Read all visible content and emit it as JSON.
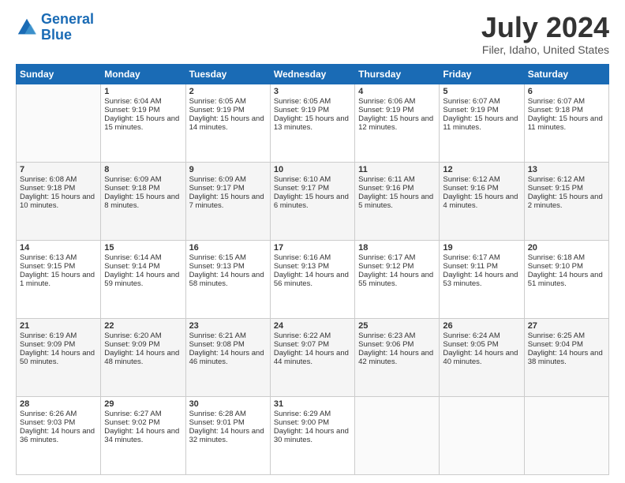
{
  "logo": {
    "line1": "General",
    "line2": "Blue"
  },
  "title": "July 2024",
  "subtitle": "Filer, Idaho, United States",
  "days_header": [
    "Sunday",
    "Monday",
    "Tuesday",
    "Wednesday",
    "Thursday",
    "Friday",
    "Saturday"
  ],
  "weeks": [
    [
      {
        "day": "",
        "sunrise": "",
        "sunset": "",
        "daylight": ""
      },
      {
        "day": "1",
        "sunrise": "Sunrise: 6:04 AM",
        "sunset": "Sunset: 9:19 PM",
        "daylight": "Daylight: 15 hours and 15 minutes."
      },
      {
        "day": "2",
        "sunrise": "Sunrise: 6:05 AM",
        "sunset": "Sunset: 9:19 PM",
        "daylight": "Daylight: 15 hours and 14 minutes."
      },
      {
        "day": "3",
        "sunrise": "Sunrise: 6:05 AM",
        "sunset": "Sunset: 9:19 PM",
        "daylight": "Daylight: 15 hours and 13 minutes."
      },
      {
        "day": "4",
        "sunrise": "Sunrise: 6:06 AM",
        "sunset": "Sunset: 9:19 PM",
        "daylight": "Daylight: 15 hours and 12 minutes."
      },
      {
        "day": "5",
        "sunrise": "Sunrise: 6:07 AM",
        "sunset": "Sunset: 9:19 PM",
        "daylight": "Daylight: 15 hours and 11 minutes."
      },
      {
        "day": "6",
        "sunrise": "Sunrise: 6:07 AM",
        "sunset": "Sunset: 9:18 PM",
        "daylight": "Daylight: 15 hours and 11 minutes."
      }
    ],
    [
      {
        "day": "7",
        "sunrise": "Sunrise: 6:08 AM",
        "sunset": "Sunset: 9:18 PM",
        "daylight": "Daylight: 15 hours and 10 minutes."
      },
      {
        "day": "8",
        "sunrise": "Sunrise: 6:09 AM",
        "sunset": "Sunset: 9:18 PM",
        "daylight": "Daylight: 15 hours and 8 minutes."
      },
      {
        "day": "9",
        "sunrise": "Sunrise: 6:09 AM",
        "sunset": "Sunset: 9:17 PM",
        "daylight": "Daylight: 15 hours and 7 minutes."
      },
      {
        "day": "10",
        "sunrise": "Sunrise: 6:10 AM",
        "sunset": "Sunset: 9:17 PM",
        "daylight": "Daylight: 15 hours and 6 minutes."
      },
      {
        "day": "11",
        "sunrise": "Sunrise: 6:11 AM",
        "sunset": "Sunset: 9:16 PM",
        "daylight": "Daylight: 15 hours and 5 minutes."
      },
      {
        "day": "12",
        "sunrise": "Sunrise: 6:12 AM",
        "sunset": "Sunset: 9:16 PM",
        "daylight": "Daylight: 15 hours and 4 minutes."
      },
      {
        "day": "13",
        "sunrise": "Sunrise: 6:12 AM",
        "sunset": "Sunset: 9:15 PM",
        "daylight": "Daylight: 15 hours and 2 minutes."
      }
    ],
    [
      {
        "day": "14",
        "sunrise": "Sunrise: 6:13 AM",
        "sunset": "Sunset: 9:15 PM",
        "daylight": "Daylight: 15 hours and 1 minute."
      },
      {
        "day": "15",
        "sunrise": "Sunrise: 6:14 AM",
        "sunset": "Sunset: 9:14 PM",
        "daylight": "Daylight: 14 hours and 59 minutes."
      },
      {
        "day": "16",
        "sunrise": "Sunrise: 6:15 AM",
        "sunset": "Sunset: 9:13 PM",
        "daylight": "Daylight: 14 hours and 58 minutes."
      },
      {
        "day": "17",
        "sunrise": "Sunrise: 6:16 AM",
        "sunset": "Sunset: 9:13 PM",
        "daylight": "Daylight: 14 hours and 56 minutes."
      },
      {
        "day": "18",
        "sunrise": "Sunrise: 6:17 AM",
        "sunset": "Sunset: 9:12 PM",
        "daylight": "Daylight: 14 hours and 55 minutes."
      },
      {
        "day": "19",
        "sunrise": "Sunrise: 6:17 AM",
        "sunset": "Sunset: 9:11 PM",
        "daylight": "Daylight: 14 hours and 53 minutes."
      },
      {
        "day": "20",
        "sunrise": "Sunrise: 6:18 AM",
        "sunset": "Sunset: 9:10 PM",
        "daylight": "Daylight: 14 hours and 51 minutes."
      }
    ],
    [
      {
        "day": "21",
        "sunrise": "Sunrise: 6:19 AM",
        "sunset": "Sunset: 9:09 PM",
        "daylight": "Daylight: 14 hours and 50 minutes."
      },
      {
        "day": "22",
        "sunrise": "Sunrise: 6:20 AM",
        "sunset": "Sunset: 9:09 PM",
        "daylight": "Daylight: 14 hours and 48 minutes."
      },
      {
        "day": "23",
        "sunrise": "Sunrise: 6:21 AM",
        "sunset": "Sunset: 9:08 PM",
        "daylight": "Daylight: 14 hours and 46 minutes."
      },
      {
        "day": "24",
        "sunrise": "Sunrise: 6:22 AM",
        "sunset": "Sunset: 9:07 PM",
        "daylight": "Daylight: 14 hours and 44 minutes."
      },
      {
        "day": "25",
        "sunrise": "Sunrise: 6:23 AM",
        "sunset": "Sunset: 9:06 PM",
        "daylight": "Daylight: 14 hours and 42 minutes."
      },
      {
        "day": "26",
        "sunrise": "Sunrise: 6:24 AM",
        "sunset": "Sunset: 9:05 PM",
        "daylight": "Daylight: 14 hours and 40 minutes."
      },
      {
        "day": "27",
        "sunrise": "Sunrise: 6:25 AM",
        "sunset": "Sunset: 9:04 PM",
        "daylight": "Daylight: 14 hours and 38 minutes."
      }
    ],
    [
      {
        "day": "28",
        "sunrise": "Sunrise: 6:26 AM",
        "sunset": "Sunset: 9:03 PM",
        "daylight": "Daylight: 14 hours and 36 minutes."
      },
      {
        "day": "29",
        "sunrise": "Sunrise: 6:27 AM",
        "sunset": "Sunset: 9:02 PM",
        "daylight": "Daylight: 14 hours and 34 minutes."
      },
      {
        "day": "30",
        "sunrise": "Sunrise: 6:28 AM",
        "sunset": "Sunset: 9:01 PM",
        "daylight": "Daylight: 14 hours and 32 minutes."
      },
      {
        "day": "31",
        "sunrise": "Sunrise: 6:29 AM",
        "sunset": "Sunset: 9:00 PM",
        "daylight": "Daylight: 14 hours and 30 minutes."
      },
      {
        "day": "",
        "sunrise": "",
        "sunset": "",
        "daylight": ""
      },
      {
        "day": "",
        "sunrise": "",
        "sunset": "",
        "daylight": ""
      },
      {
        "day": "",
        "sunrise": "",
        "sunset": "",
        "daylight": ""
      }
    ]
  ]
}
